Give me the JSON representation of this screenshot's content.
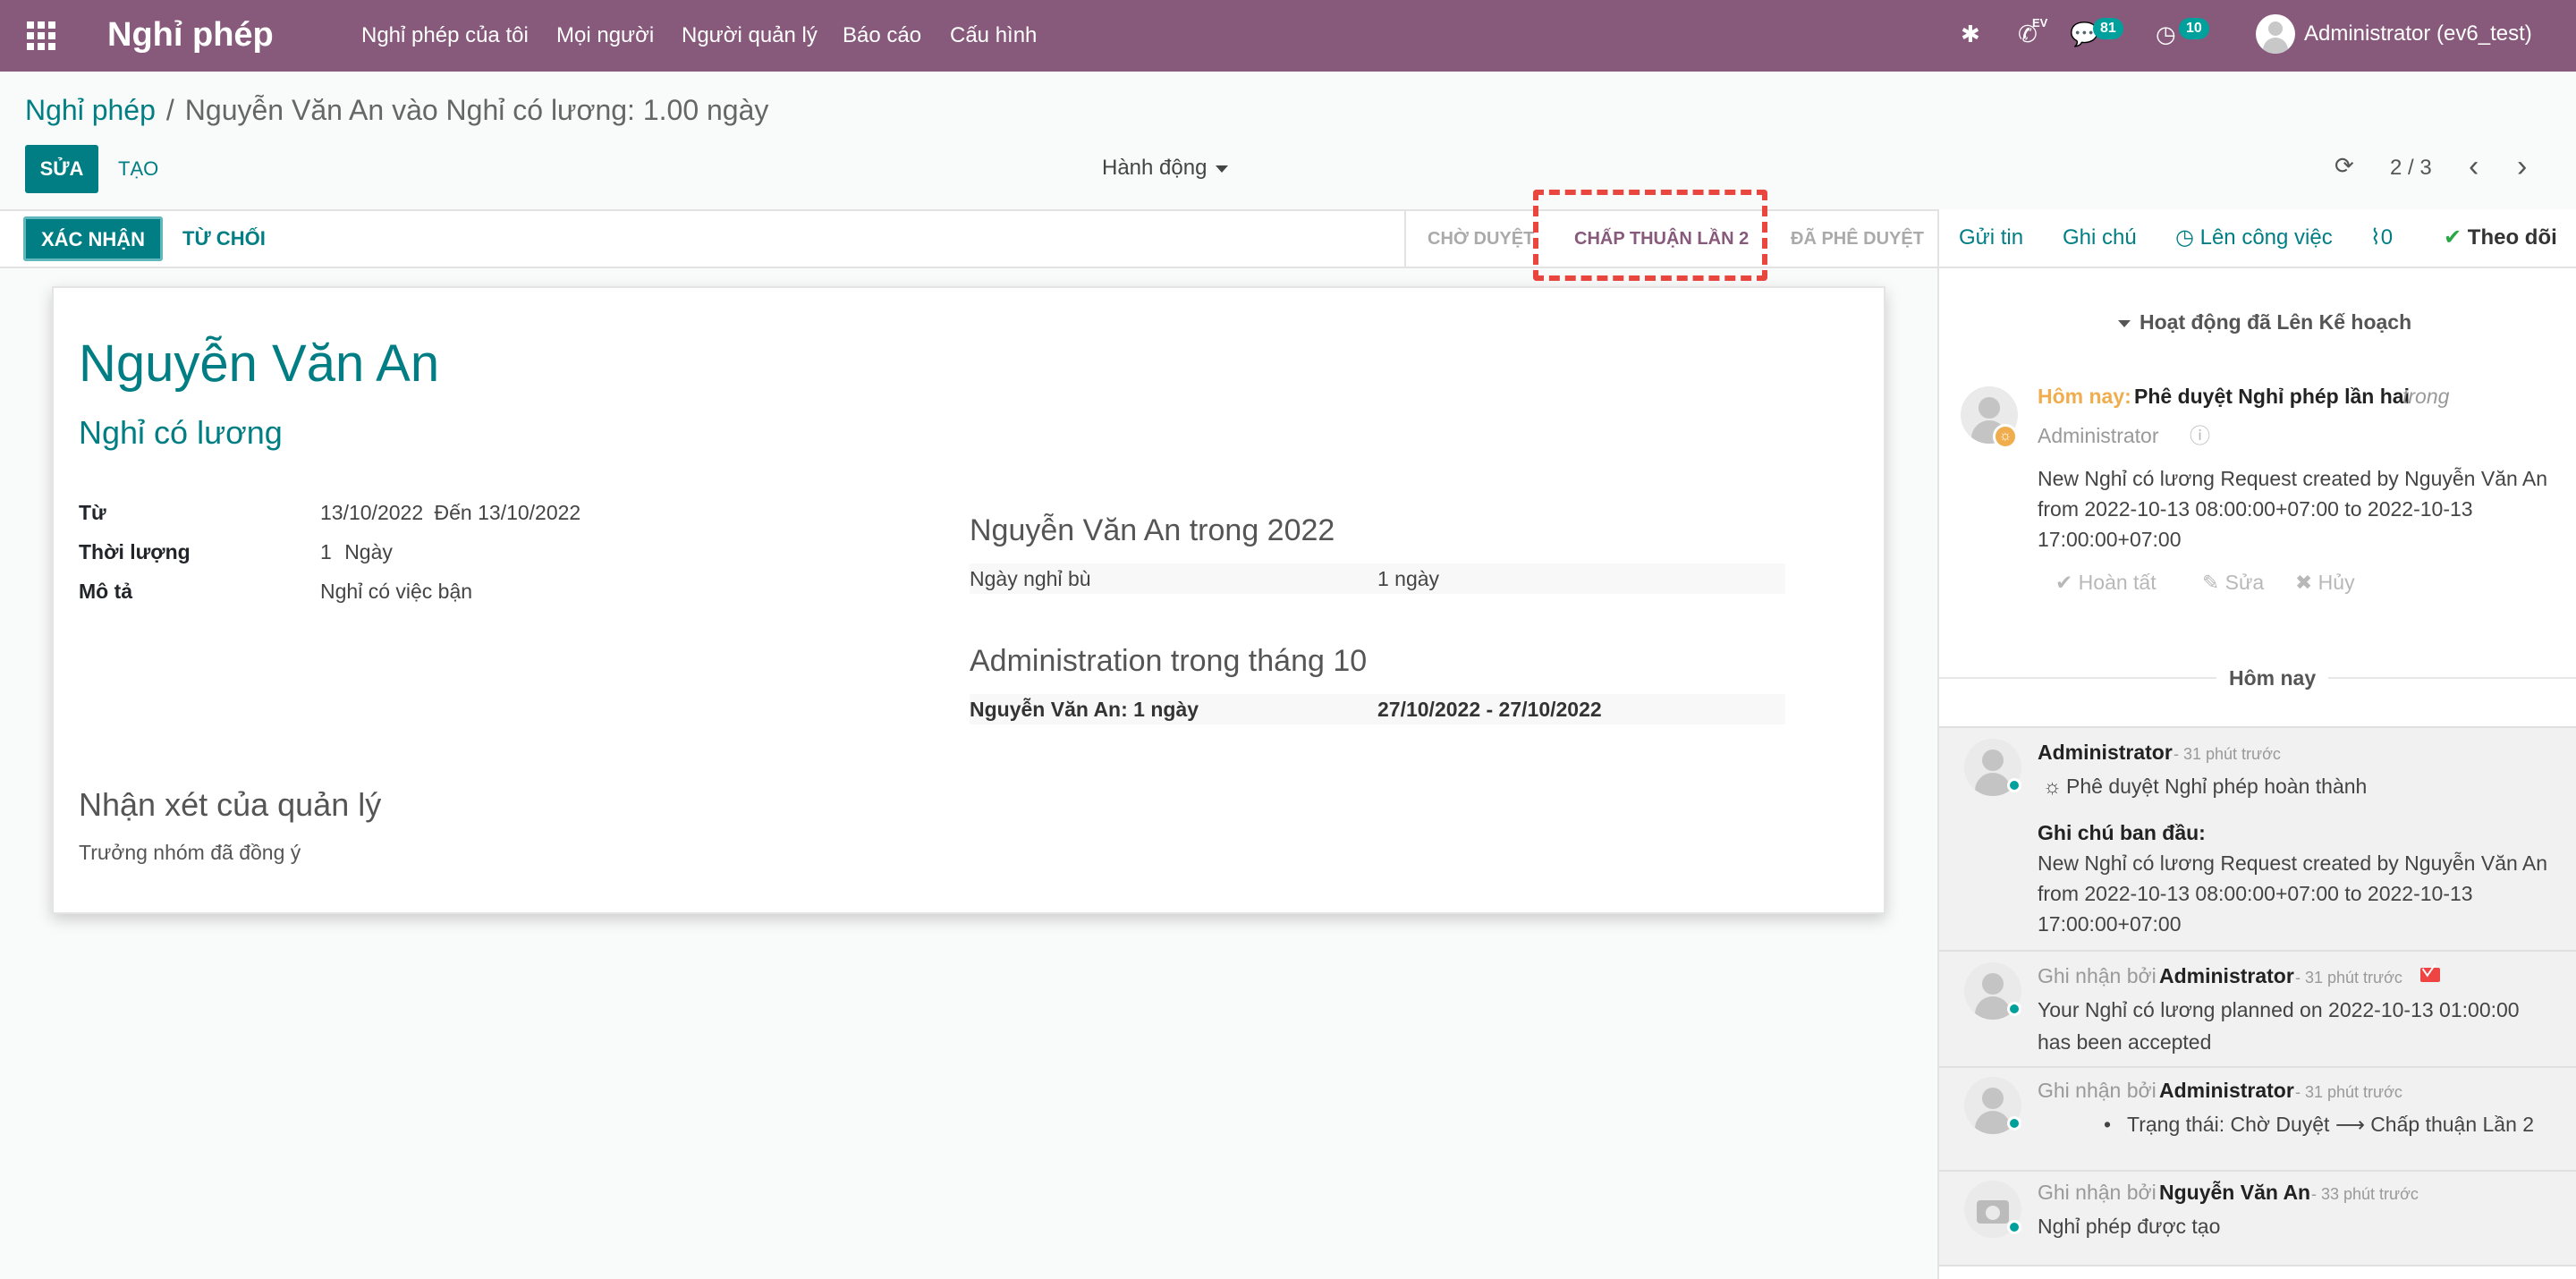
{
  "navbar": {
    "brand": "Nghỉ phép",
    "menu": [
      "Nghỉ phép của tôi",
      "Mọi người",
      "Người quản lý",
      "Báo cáo",
      "Cấu hình"
    ],
    "icons": {
      "debug": "bug-icon",
      "phone": "phone-icon",
      "phone_label": "EV",
      "messages": "chat-icon",
      "activities": "clock-icon"
    },
    "messages_count": "81",
    "activities_count": "10",
    "user": "Administrator (ev6_test)"
  },
  "breadcrumb": {
    "parent": "Nghỉ phép",
    "separator": "/",
    "current": "Nguyễn Văn An vào Nghỉ có lương: 1.00 ngày"
  },
  "toolbar": {
    "edit": "SỬA",
    "create": "TẠO",
    "action": "Hành động",
    "pager": "2 / 3"
  },
  "statusbar": {
    "confirm": "XÁC NHẬN",
    "refuse": "TỪ CHỐI",
    "stages": [
      "CHỜ DUYỆT",
      "CHẤP THUẬN LẦN 2",
      "ĐÃ PHÊ DUYỆT"
    ],
    "active_stage": "CHẤP THUẬN LẦN 2"
  },
  "form": {
    "employee": "Nguyễn Văn An",
    "leave_type": "Nghỉ có lương",
    "fields": {
      "from_label": "Từ",
      "from_value": "13/10/2022",
      "to_label": "Đến",
      "to_value": "13/10/2022",
      "duration_label": "Thời lượng",
      "duration_value": "1",
      "duration_unit": "Ngày",
      "desc_label": "Mô tả",
      "desc_value": "Nghỉ có việc bận"
    },
    "year_section": {
      "title": "Nguyễn Văn An trong 2022",
      "row_label": "Ngày nghỉ bù",
      "row_value": "1 ngày"
    },
    "month_section": {
      "title": "Administration trong tháng 10",
      "row_label": "Nguyễn Văn An: 1 ngày",
      "row_value": "27/10/2022 - 27/10/2022"
    },
    "manager_title": "Nhận xét của quản lý",
    "manager_text": "Trưởng nhóm đã đồng ý"
  },
  "chatter": {
    "send_message": "Gửi tin",
    "log_note": "Ghi chú",
    "schedule": "Lên công việc",
    "attachments": "0",
    "follow": "Theo dõi",
    "activity_header": "Hoạt động đã Lên Kế hoạch",
    "activity": {
      "when": "Hôm nay:",
      "summary": "Phê duyệt Nghỉ phép lần hai",
      "suffix": "trong",
      "user": "Administrator",
      "note": [
        "New Nghỉ có lương Request created by Nguyễn Văn An",
        "from 2022-10-13 08:00:00+07:00 to 2022-10-13",
        "17:00:00+07:00"
      ],
      "done": "Hoàn tất",
      "edit": "Sửa",
      "cancel": "Hủy"
    },
    "today_label": "Hôm nay",
    "messages": [
      {
        "author": "Administrator",
        "time": "- 31 phút trước",
        "subject": "Phê duyệt Nghỉ phép hoàn thành",
        "note_title": "Ghi chú ban đầu:",
        "lines": [
          "New Nghỉ có lương Request created by Nguyễn Văn An",
          "from 2022-10-13 08:00:00+07:00 to 2022-10-13",
          "17:00:00+07:00"
        ]
      },
      {
        "prefix": "Ghi nhận bởi",
        "author": "Administrator",
        "time": "- 31 phút trước",
        "lines": [
          "Your Nghỉ có lương planned on 2022-10-13 01:00:00",
          "has been accepted"
        ]
      },
      {
        "prefix": "Ghi nhận bởi",
        "author": "Administrator",
        "time": "- 31 phút trước",
        "tracking": "Trạng thái: Chờ Duyệt ⟶ Chấp thuận Lần 2"
      },
      {
        "prefix": "Ghi nhận bởi",
        "author": "Nguyễn Văn An",
        "time": "- 33 phút trước",
        "body": "Nghỉ phép được tạo"
      }
    ]
  },
  "colors": {
    "brand": "#875a7b",
    "accent": "#017e84",
    "highlight": "#e8463f"
  }
}
